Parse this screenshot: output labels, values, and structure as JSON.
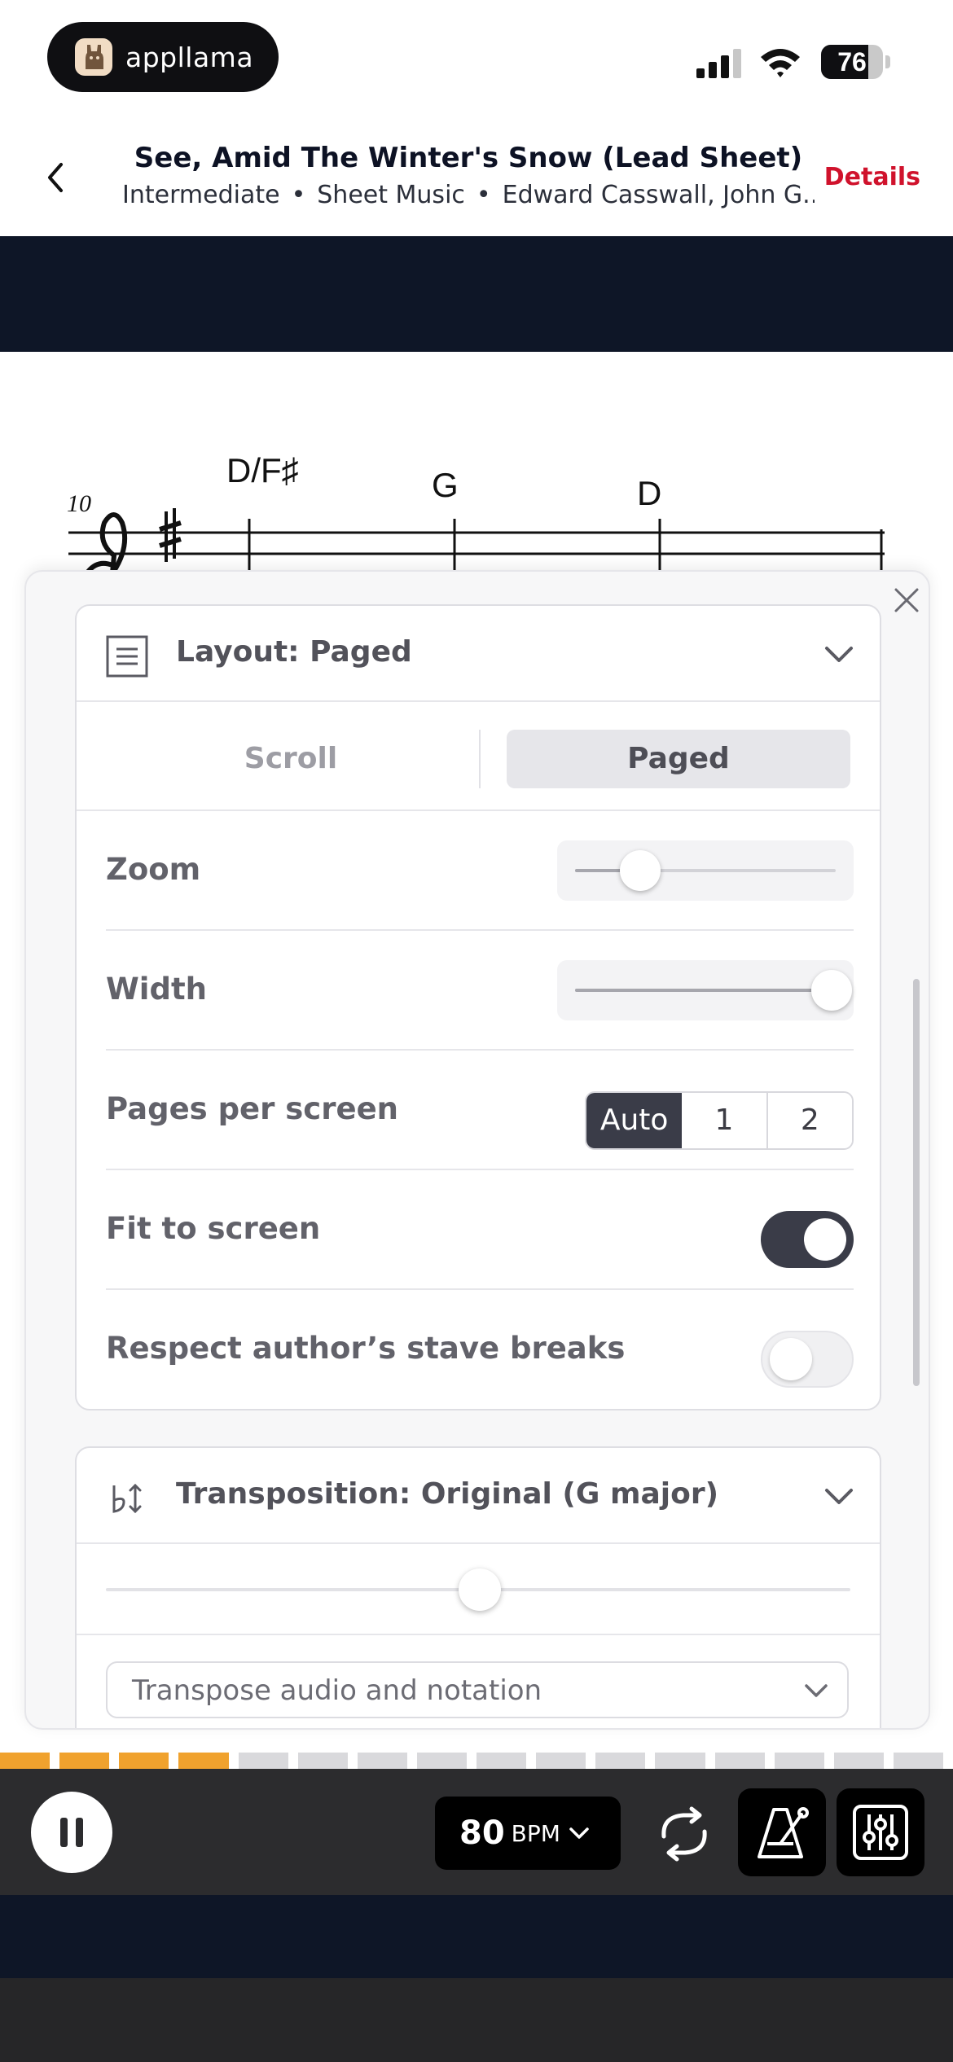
{
  "status_bar": {
    "app_name": "appllama",
    "battery_level": "76",
    "battery_fraction": 0.76,
    "icons": [
      "app-logo-icon",
      "signal-icon",
      "wifi-icon",
      "battery-icon"
    ]
  },
  "header": {
    "title": "See, Amid The Winter's Snow (Lead Sheet)",
    "level": "Intermediate",
    "type": "Sheet Music",
    "composers": "Edward Casswall, John G...",
    "separator": "•",
    "details_label": "Details"
  },
  "score": {
    "measure_number": "10",
    "chords": [
      "D/F♯",
      "G",
      "D"
    ]
  },
  "panel": {
    "layout_card": {
      "title": "Layout: Paged",
      "mode_options": [
        "Scroll",
        "Paged"
      ],
      "selected_mode": "Paged",
      "zoom_label": "Zoom",
      "zoom_value": 0.25,
      "width_label": "Width",
      "width_value": 1.0,
      "pages_label": "Pages per screen",
      "pages_options": [
        "Auto",
        "1",
        "2"
      ],
      "pages_selected": "Auto",
      "fit_label": "Fit to screen",
      "fit_on": true,
      "stave_label": "Respect author’s stave breaks",
      "stave_on": false
    },
    "transposition_card": {
      "title": "Transposition: Original (G major)",
      "slider_value": 0.5,
      "select_value": "Transpose audio and notation"
    }
  },
  "player": {
    "progress_filled_segments": 4,
    "progress_total_segments": 16,
    "progress_color": "#f0a22e",
    "progress_empty_color": "#d9d9dc",
    "bpm_value": "80",
    "bpm_unit": "BPM",
    "icons": [
      "pause-icon",
      "chevron-down-icon",
      "loop-icon",
      "metronome-icon",
      "mixer-icon"
    ]
  }
}
